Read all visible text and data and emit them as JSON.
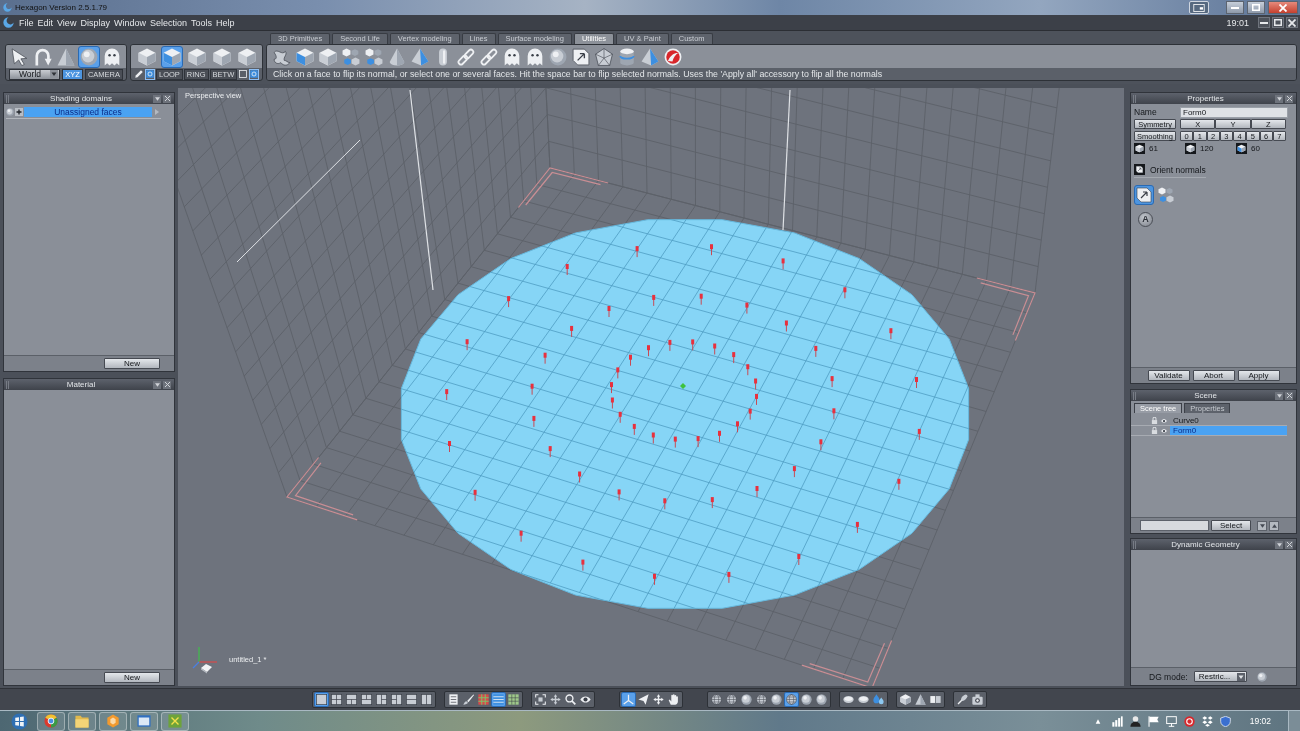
{
  "window": {
    "title": "Hexagon Version 2.5.1.79"
  },
  "menu": {
    "items": [
      "File",
      "Edit",
      "View",
      "Display",
      "Window",
      "Selection",
      "Tools",
      "Help"
    ],
    "clock": "19:01"
  },
  "toolbar": {
    "tabs": [
      {
        "label": "3D Primitives",
        "selected": false
      },
      {
        "label": "Second Life",
        "selected": false
      },
      {
        "label": "Vertex modeling",
        "selected": false
      },
      {
        "label": "Lines",
        "selected": false
      },
      {
        "label": "Surface modeling",
        "selected": false
      },
      {
        "label": "Utilities",
        "selected": true
      },
      {
        "label": "UV & Paint",
        "selected": false
      },
      {
        "label": "Custom",
        "selected": false
      }
    ],
    "selection_modes": [
      {
        "selected": false
      },
      {
        "selected": false
      },
      {
        "selected": false
      },
      {
        "selected": true
      },
      {
        "selected": false
      }
    ],
    "space": "World",
    "space_buttons": [
      {
        "label": "XYZ",
        "selected": true
      },
      {
        "label": "CAMERA",
        "selected": false
      }
    ],
    "component_modes": [
      {
        "selected": false
      },
      {
        "selected": true
      },
      {
        "selected": false
      },
      {
        "selected": false
      },
      {
        "selected": false
      }
    ],
    "component_options": [
      {
        "kind": "icon",
        "selected": false
      },
      {
        "kind": "icon",
        "selected": true
      },
      {
        "kind": "label",
        "label": "LOOP",
        "selected": false
      },
      {
        "kind": "label",
        "label": "RING",
        "selected": false
      },
      {
        "kind": "label",
        "label": "BETW",
        "selected": false
      },
      {
        "kind": "icon",
        "selected": false
      },
      {
        "kind": "icon",
        "selected": true
      }
    ],
    "hint": "Click on a face to flip its normal, or select one or several faces. Hit the space bar to flip selected normals. Uses the 'Apply all' accessory to flip all the normals"
  },
  "shading_domains": {
    "title": "Shading domains",
    "items": [
      {
        "label": "Unassigned faces",
        "selected": true
      }
    ],
    "button": "New"
  },
  "material": {
    "title": "Material",
    "button": "New"
  },
  "viewport": {
    "title": "Perspective view",
    "document": "untitled_1 *"
  },
  "properties": {
    "title": "Properties",
    "name_label": "Name",
    "name_value": "Form0",
    "symmetry_label": "Symmetry",
    "axes": [
      "X",
      "Y",
      "Z"
    ],
    "smoothing_label": "Smoothing",
    "smoothing_levels": [
      "0",
      "1",
      "2",
      "3",
      "4",
      "5",
      "6",
      "7"
    ],
    "counts": [
      "61",
      "120",
      "60"
    ],
    "section": "Orient normals",
    "tools": [
      {
        "selected": true
      },
      {
        "selected": false
      }
    ],
    "accessory": "A",
    "buttons": [
      "Validate",
      "Abort",
      "Apply"
    ]
  },
  "scene": {
    "title": "Scene",
    "tabs": [
      {
        "label": "Scene tree",
        "selected": true
      },
      {
        "label": "Properties",
        "selected": false
      }
    ],
    "items": [
      {
        "label": "Curve0",
        "selected": false
      },
      {
        "label": "Form0",
        "selected": true
      }
    ],
    "select_button": "Select"
  },
  "dynamic_geometry": {
    "title": "Dynamic Geometry",
    "mode_label": "DG mode:",
    "mode": "Restric..."
  },
  "bottom_toolbar": {
    "layouts": [
      {
        "selected": true
      },
      {
        "selected": false
      },
      {
        "selected": false
      },
      {
        "selected": false
      },
      {
        "selected": false
      },
      {
        "selected": false
      },
      {
        "selected": false
      },
      {
        "selected": false
      }
    ],
    "display": [
      {
        "selected": false
      },
      {
        "selected": false
      },
      {
        "selected": false
      },
      {
        "selected": true
      },
      {
        "selected": false
      }
    ],
    "navigation": [
      {
        "selected": true
      },
      {
        "selected": false
      },
      {
        "selected": false
      },
      {
        "selected": false
      }
    ],
    "render_modes": [
      {
        "selected": false
      },
      {
        "selected": false
      },
      {
        "selected": false
      },
      {
        "selected": false
      },
      {
        "selected": false
      },
      {
        "selected": true
      },
      {
        "selected": false
      },
      {
        "selected": false
      }
    ]
  },
  "taskbar": {
    "clock": "19:02"
  }
}
